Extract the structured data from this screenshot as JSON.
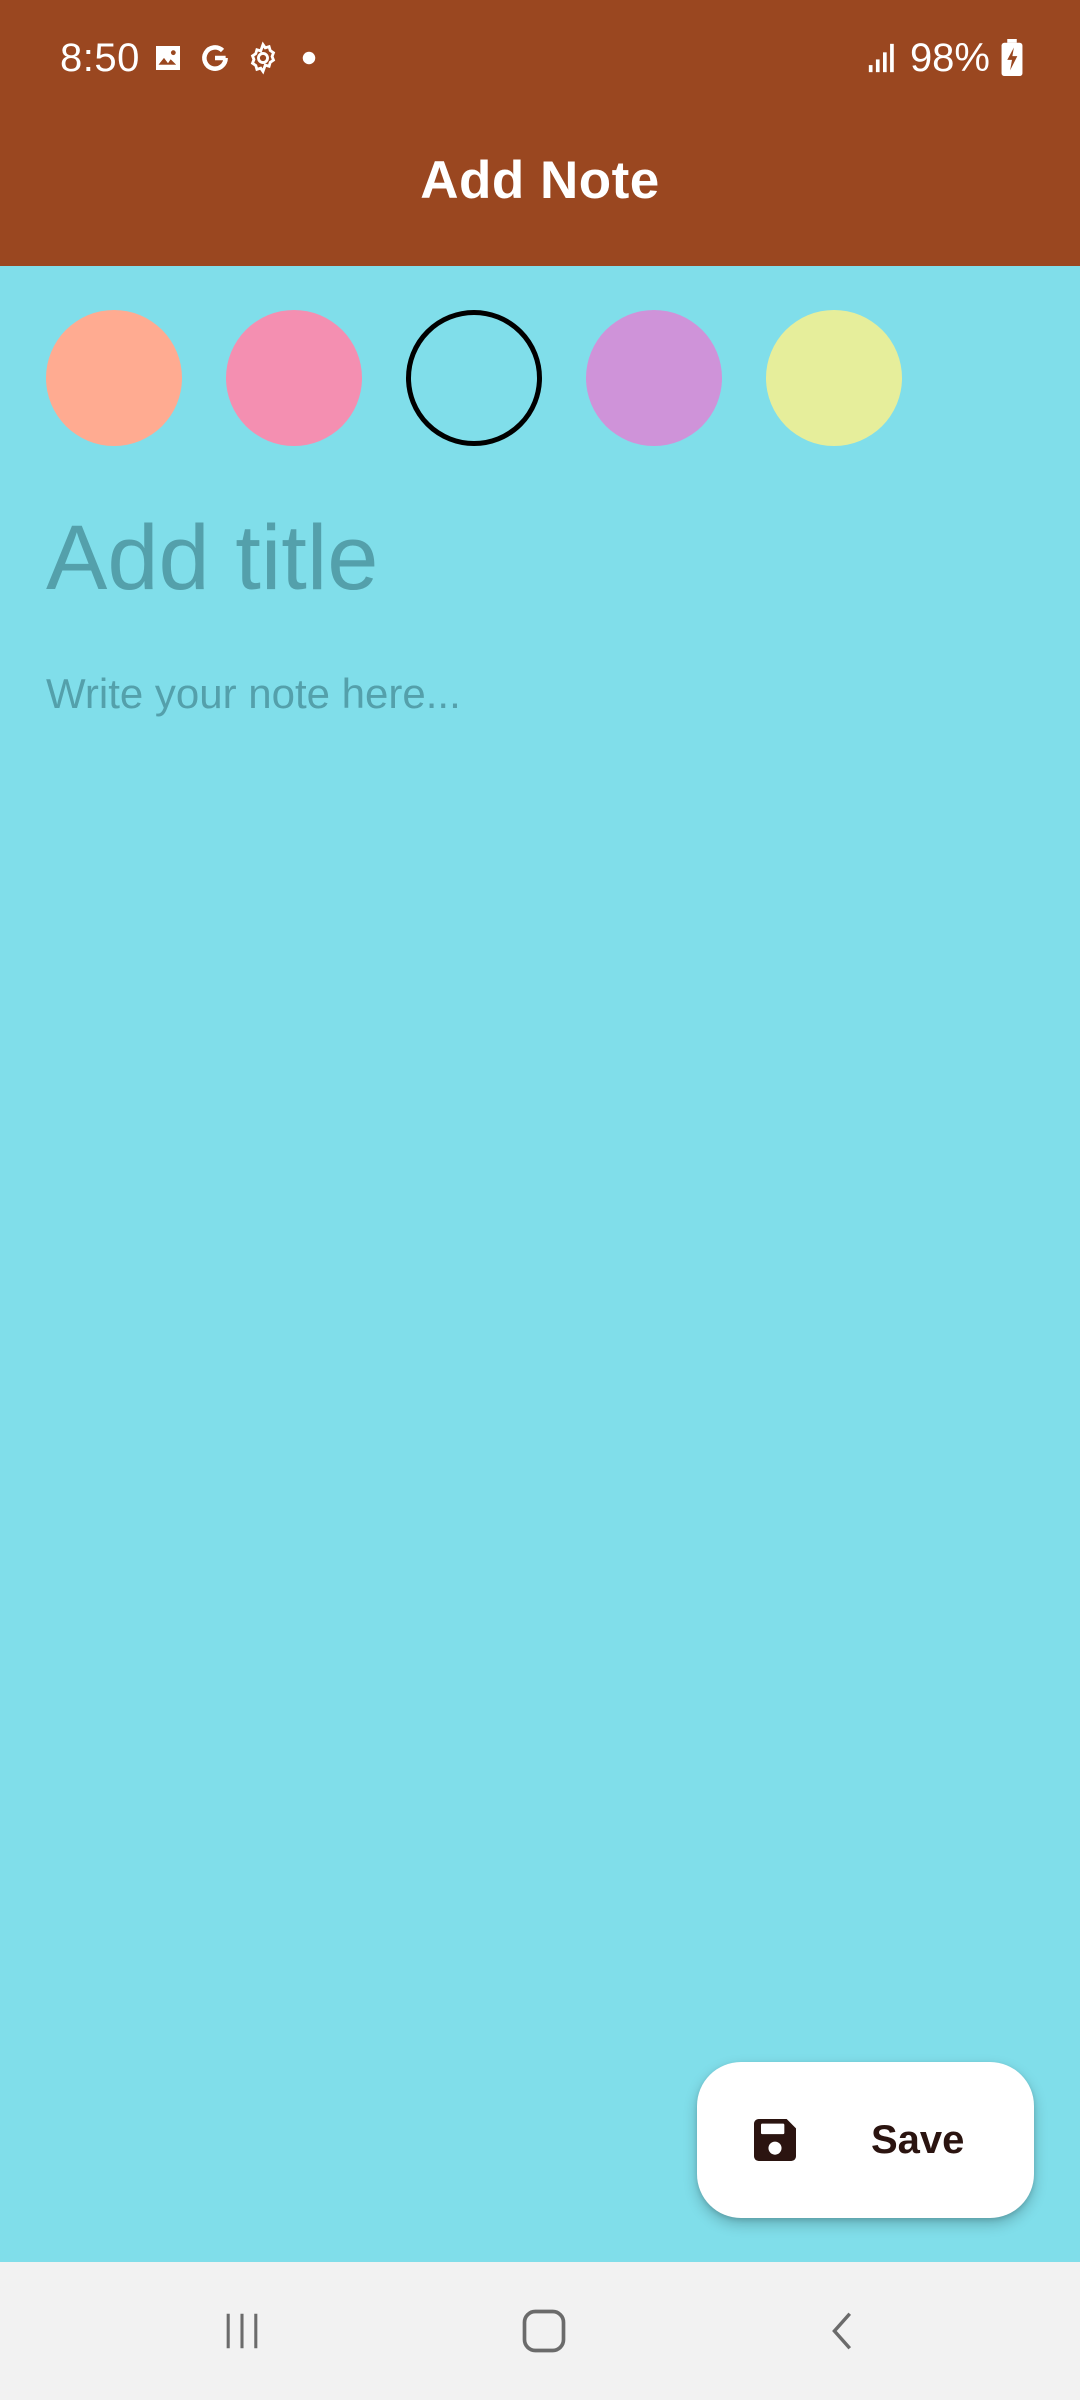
{
  "status_bar": {
    "time": "8:50",
    "battery": "98%",
    "icons": [
      "image-icon",
      "google-icon",
      "settings-icon",
      "dot-icon",
      "signal-icon",
      "battery-charging-icon"
    ]
  },
  "app_bar": {
    "title": "Add Note"
  },
  "color_picker": {
    "colors": [
      "#ffab91",
      "#f48fb1",
      "#80deea",
      "#cf93d9",
      "#e6ee9b"
    ],
    "selected_index": 2
  },
  "editor": {
    "title_placeholder": "Add title",
    "title_value": "",
    "body_placeholder": "Write your note here...",
    "body_value": ""
  },
  "save_button": {
    "label": "Save",
    "icon": "save-icon"
  },
  "nav_bar": {
    "buttons": [
      "recent-apps-icon",
      "home-icon",
      "back-icon"
    ]
  },
  "theme": {
    "primary": "#9a4720",
    "background": "#80deea"
  }
}
